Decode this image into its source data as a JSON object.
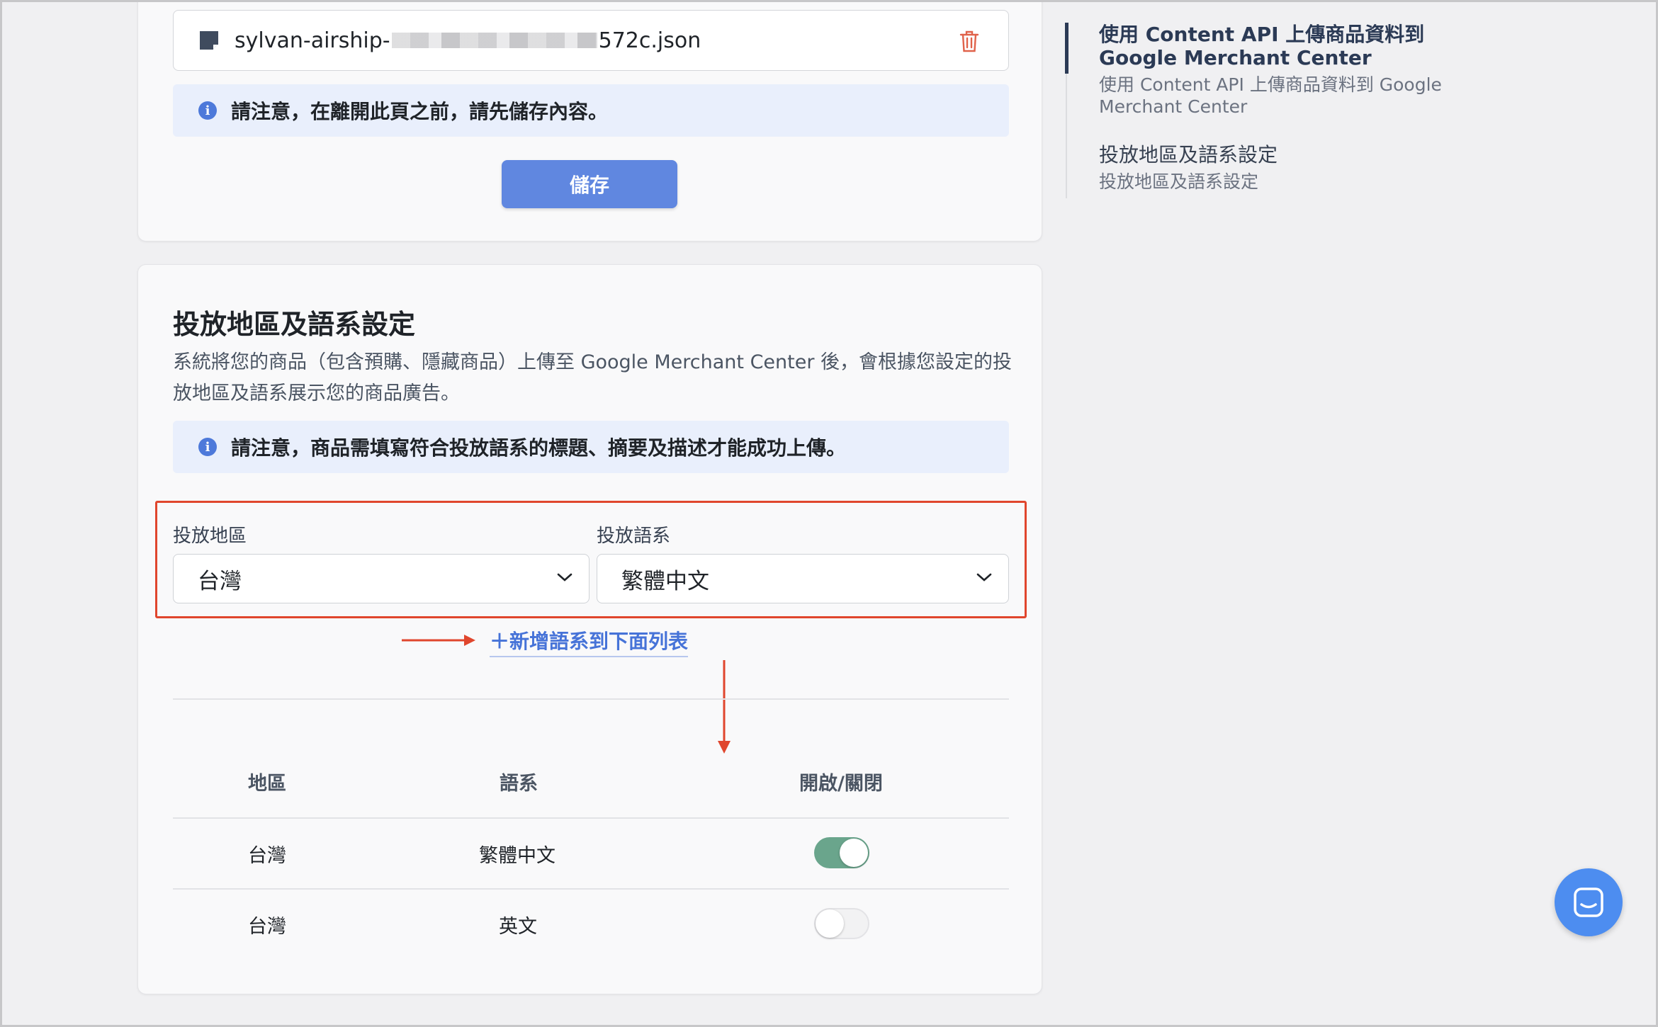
{
  "file": {
    "name_prefix": "sylvan-airship-",
    "name_suffix": "572c.json"
  },
  "notice_save": "請注意，在離開此頁之前，請先儲存內容。",
  "save_button": "儲存",
  "section": {
    "title": "投放地區及語系設定",
    "description": "系統將您的商品（包含預購、隱藏商品）上傳至 Google Merchant Center 後，會根據您設定的投放地區及語系展示您的商品廣告。",
    "notice": "請注意，商品需填寫符合投放語系的標題、摘要及描述才能成功上傳。",
    "region_label": "投放地區",
    "region_value": "台灣",
    "language_label": "投放語系",
    "language_value": "繁體中文",
    "add_link": "＋新增語系到下面列表"
  },
  "table": {
    "headers": [
      "地區",
      "語系",
      "開啟/關閉"
    ],
    "rows": [
      {
        "region": "台灣",
        "language": "繁體中文",
        "enabled": true
      },
      {
        "region": "台灣",
        "language": "英文",
        "enabled": false
      }
    ]
  },
  "toc": [
    {
      "title": "使用 Content API 上傳商品資料到 Google Merchant Center",
      "subtitle": "使用 Content API 上傳商品資料到 Google Merchant Center",
      "active": true
    },
    {
      "title": "投放地區及語系設定",
      "subtitle": "投放地區及語系設定",
      "active": false
    }
  ],
  "colors": {
    "accent": "#6087e0",
    "link": "#4673d8",
    "toggle_on": "#6aa58c",
    "annotation": "#e0462d",
    "notice_bg": "#e9effc"
  },
  "icons": [
    "file-icon",
    "trash-icon",
    "info-icon",
    "chevron-down-icon",
    "chat-icon"
  ]
}
